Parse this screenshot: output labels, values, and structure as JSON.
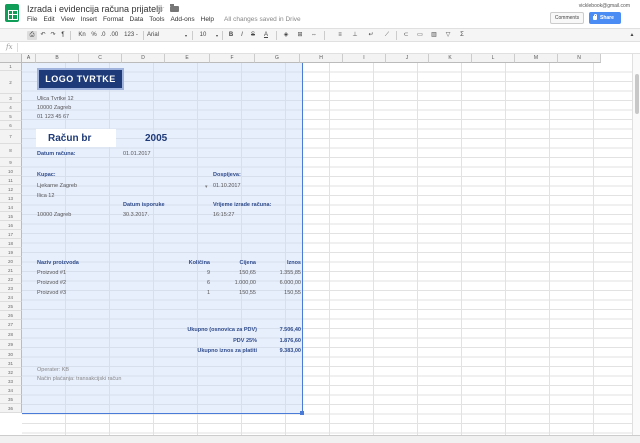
{
  "app": {
    "doc_title": "Izrada i evidencija računa prijatelji",
    "user_email": "vicklebook@gmail.com",
    "comments_label": "Comments",
    "share_label": "Share",
    "accent_color": "#4b8bf4",
    "brand_color": "#0f9d58"
  },
  "menu": [
    "File",
    "Edit",
    "View",
    "Insert",
    "Format",
    "Data",
    "Tools",
    "Add-ons",
    "Help"
  ],
  "save_status": "All changes saved in Drive",
  "toolbar": {
    "currency": "Kn",
    "percent": "%",
    "dec_dec": ".0",
    "dec_inc": ".00",
    "more_formats": "123 -",
    "font": "Arial",
    "font_size": "10",
    "bold": "B",
    "italic": "I",
    "strike": "S",
    "text_color": "A"
  },
  "columns": [
    "A",
    "B",
    "C",
    "D",
    "E",
    "F",
    "G",
    "H",
    "I",
    "J",
    "K",
    "L",
    "M",
    "N"
  ],
  "rows": [
    "1",
    "2",
    "3",
    "4",
    "5",
    "6",
    "7",
    "8",
    "9",
    "10",
    "11",
    "12",
    "13",
    "14",
    "15",
    "16",
    "17",
    "18",
    "19",
    "20",
    "21",
    "22",
    "23",
    "24",
    "25",
    "26",
    "27",
    "28",
    "29",
    "30",
    "31",
    "32",
    "33",
    "34",
    "35",
    "36"
  ],
  "invoice": {
    "logo_text": "LOGO TVRTKE",
    "company_name": "Ulica Tvrtke 12",
    "company_city": "10000 Zagreb",
    "company_phone": "01 123 45 67",
    "title": "Račun br",
    "number": "2005",
    "date_label": "Datum računa:",
    "date_value": "01.01.2017",
    "buyer_label": "Kupac:",
    "buyer_name": "Ljekarne Zagreb",
    "buyer_street": "Ilica 12",
    "buyer_city": "10000 Zagreb",
    "due_label": "Dospijeva:",
    "due_value": "01.10.2017",
    "delivery_label": "Datum isporuke",
    "delivery_value": "30.3.2017.",
    "created_label": "Vrijeme izrade računa:",
    "created_value": "16:15:27",
    "headers": {
      "product": "Naziv proizvoda",
      "qty": "Količina",
      "price": "Cijena",
      "amount": "Iznos"
    },
    "items": [
      {
        "name": "Proizvod #1",
        "qty": "9",
        "price": "150,65",
        "amount": "1.355,85"
      },
      {
        "name": "Proizvod #2",
        "qty": "6",
        "price": "1.000,00",
        "amount": "6.000,00"
      },
      {
        "name": "Proizvod #3",
        "qty": "1",
        "price": "150,55",
        "amount": "150,55"
      }
    ],
    "subtotal_label": "Ukupno (osnovica za PDV)",
    "subtotal_value": "7.506,40",
    "vat_label": "PDV 25%",
    "vat_value": "1.876,60",
    "total_label": "Ukupno iznos za platiti",
    "total_value": "9.383,00",
    "operator": "Operater: KB",
    "payment": "Način plaćanja: transakcijski račun"
  }
}
